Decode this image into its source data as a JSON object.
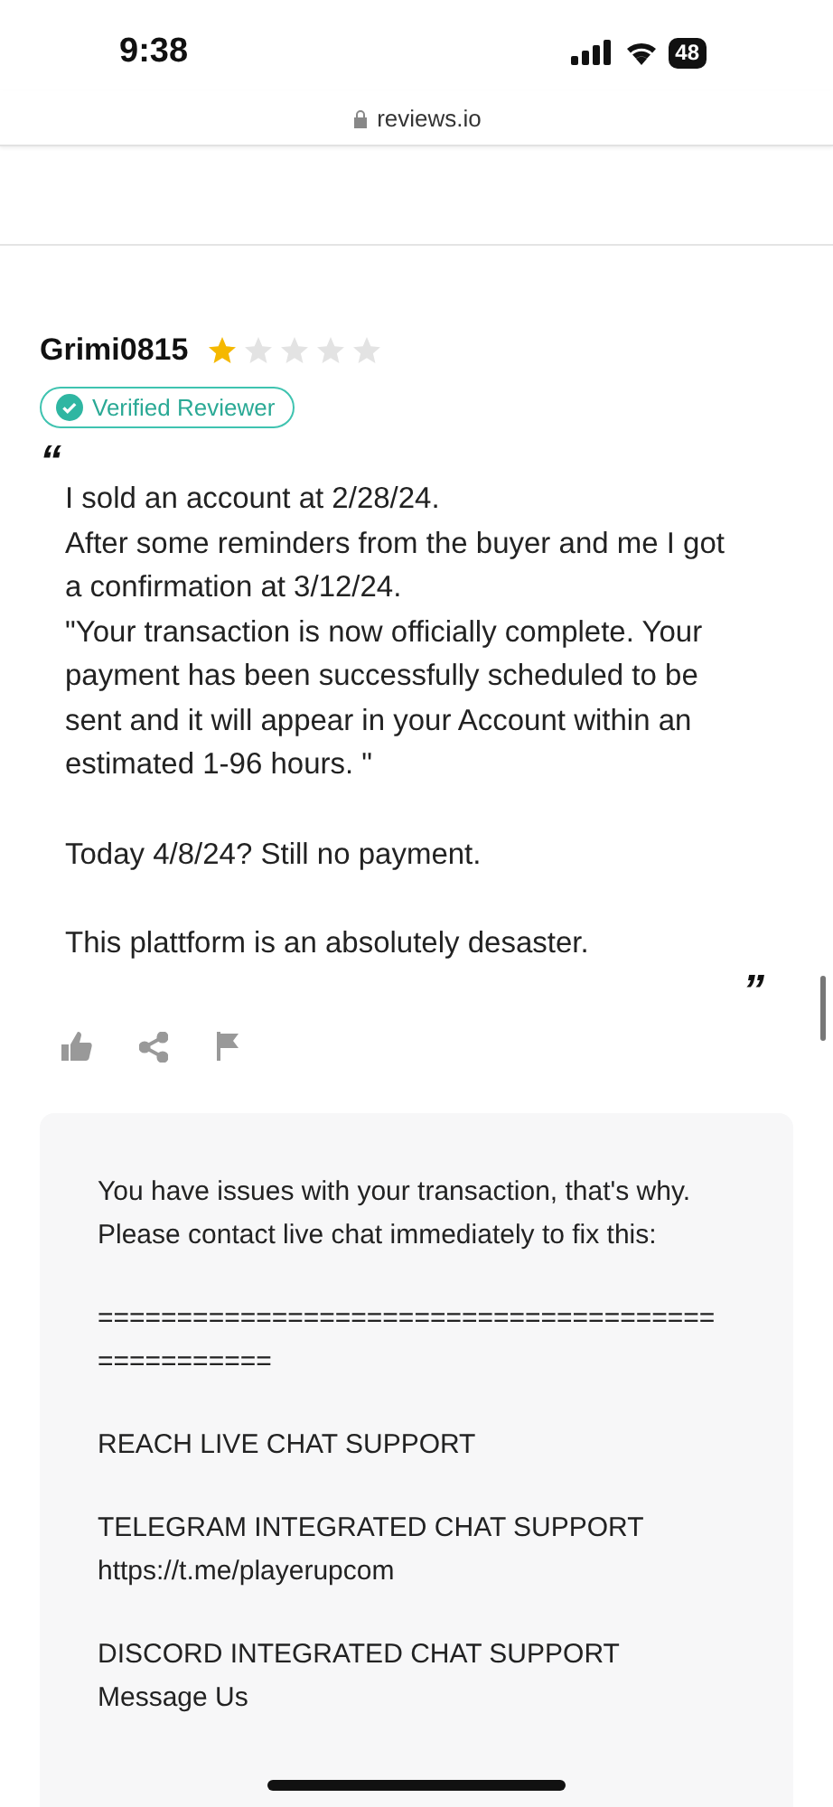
{
  "status_bar": {
    "time": "9:38",
    "battery": "48"
  },
  "address_bar": {
    "url": "reviews.io"
  },
  "review": {
    "author": "Grimi0815",
    "stars": 1,
    "badge": "Verified Reviewer",
    "open_quote": "“",
    "close_quote": "”",
    "paragraphs": [
      "I sold an account at 2/28/24.\nAfter some reminders from the buyer and me I got a confirmation  at 3/12/24.\n\"Your transaction is now officially complete. Your payment has been successfully scheduled to be sent and it will appear in your Account within an estimated 1-96 hours. \"",
      "Today 4/8/24? Still no payment.",
      "This plattform is an absolutely desaster."
    ]
  },
  "reply": {
    "paragraphs": [
      "You have issues with your transaction, that's why. Please contact live chat immediately to fix this:",
      "==================================================",
      "REACH LIVE CHAT SUPPORT",
      "TELEGRAM INTEGRATED CHAT SUPPORT\nhttps://t.me/playerupcom",
      "DISCORD INTEGRATED CHAT SUPPORT\nMessage Us"
    ]
  }
}
